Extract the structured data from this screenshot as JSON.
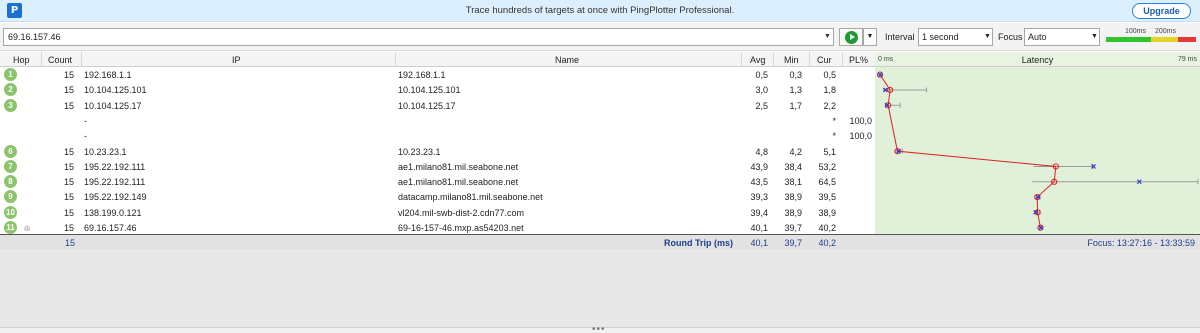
{
  "banner": {
    "logo": "P",
    "text": "Trace hundreds of targets at once with PingPlotter Professional.",
    "upgrade_label": "Upgrade"
  },
  "toolbar": {
    "target_value": "69.16.157.46",
    "interval_label": "Interval",
    "interval_value": "1 second",
    "focus_label": "Focus",
    "focus_value": "Auto",
    "scale_100": "100ms",
    "scale_200": "200ms",
    "colors": {
      "good": "#2dc42d",
      "warn": "#e5d427",
      "bad": "#e23a3a",
      "play": "#1e9a34"
    }
  },
  "columns": {
    "hop": "Hop",
    "count": "Count",
    "ip": "IP",
    "name": "Name",
    "avg": "Avg",
    "min": "Min",
    "cur": "Cur",
    "pl": "PL%",
    "latency": "Latency",
    "latency_min": "0 ms",
    "latency_max": "79 ms"
  },
  "hops": [
    {
      "hop": "1",
      "count": "15",
      "ip": "192.168.1.1",
      "name": "192.168.1.1",
      "avg": "0,5",
      "min": "0,3",
      "cur": "0,5",
      "pl": ""
    },
    {
      "hop": "2",
      "count": "15",
      "ip": "10.104.125.101",
      "name": "10.104.125.101",
      "avg": "3,0",
      "min": "1,3",
      "cur": "1,8",
      "pl": ""
    },
    {
      "hop": "3",
      "count": "15",
      "ip": "10.104.125.17",
      "name": "10.104.125.17",
      "avg": "2,5",
      "min": "1,7",
      "cur": "2,2",
      "pl": ""
    },
    {
      "hop": "",
      "count": "",
      "ip": "-",
      "name": "",
      "avg": "",
      "min": "",
      "cur": "*",
      "pl": "100,0"
    },
    {
      "hop": "",
      "count": "",
      "ip": "-",
      "name": "",
      "avg": "",
      "min": "",
      "cur": "*",
      "pl": "100,0"
    },
    {
      "hop": "6",
      "count": "15",
      "ip": "10.23.23.1",
      "name": "10.23.23.1",
      "avg": "4,8",
      "min": "4,2",
      "cur": "5,1",
      "pl": ""
    },
    {
      "hop": "7",
      "count": "15",
      "ip": "195.22.192.111",
      "name": "ae1.milano81.mil.seabone.net",
      "avg": "43,9",
      "min": "38,4",
      "cur": "53,2",
      "pl": ""
    },
    {
      "hop": "8",
      "count": "15",
      "ip": "195.22.192.111",
      "name": "ae1.milano81.mil.seabone.net",
      "avg": "43,5",
      "min": "38,1",
      "cur": "64,5",
      "pl": ""
    },
    {
      "hop": "9",
      "count": "15",
      "ip": "195.22.192.149",
      "name": "datacamp.milano81.mil.seabone.net",
      "avg": "39,3",
      "min": "38,9",
      "cur": "39,5",
      "pl": ""
    },
    {
      "hop": "10",
      "count": "15",
      "ip": "138.199.0.121",
      "name": "vl204.mil-swb-dist-2.cdn77.com",
      "avg": "39,4",
      "min": "38,9",
      "cur": "38,9",
      "pl": ""
    },
    {
      "hop": "11",
      "count": "15",
      "ip": "69.16.157.46",
      "name": "69-16-157-46.mxp.as54203.net",
      "avg": "40,1",
      "min": "39,7",
      "cur": "40,2",
      "pl": ""
    }
  ],
  "summary": {
    "count": "15",
    "label": "Round Trip (ms)",
    "avg": "40,1",
    "min": "39,7",
    "cur": "40,2",
    "focus_range": "Focus: 13:27:16 - 13:33:59"
  },
  "latency_chart": {
    "max_ms": 79,
    "points": [
      {
        "hop": "1",
        "avg": 0.5,
        "cur": 0.5,
        "min": 0.3,
        "max": 1.0
      },
      {
        "hop": "2",
        "avg": 3.0,
        "cur": 1.8,
        "min": 1.3,
        "max": 12.0
      },
      {
        "hop": "3",
        "avg": 2.5,
        "cur": 2.2,
        "min": 1.7,
        "max": 5.5
      },
      {
        "hop": "6",
        "avg": 4.8,
        "cur": 5.1,
        "min": 4.2,
        "max": 6.0
      },
      {
        "hop": "7",
        "avg": 43.9,
        "cur": 53.2,
        "min": 38.4,
        "max": 53.0
      },
      {
        "hop": "8",
        "avg": 43.5,
        "cur": 64.5,
        "min": 38.1,
        "max": 79.0
      },
      {
        "hop": "9",
        "avg": 39.3,
        "cur": 39.5,
        "min": 38.9,
        "max": 40.0
      },
      {
        "hop": "10",
        "avg": 39.4,
        "cur": 38.9,
        "min": 38.9,
        "max": 40.0
      },
      {
        "hop": "11",
        "avg": 40.1,
        "cur": 40.2,
        "min": 39.7,
        "max": 40.5
      }
    ],
    "colors": {
      "line": "#e02020",
      "current": "#2a3bd1",
      "range": "#9a9a9a",
      "background": "#e1f0d8"
    }
  }
}
